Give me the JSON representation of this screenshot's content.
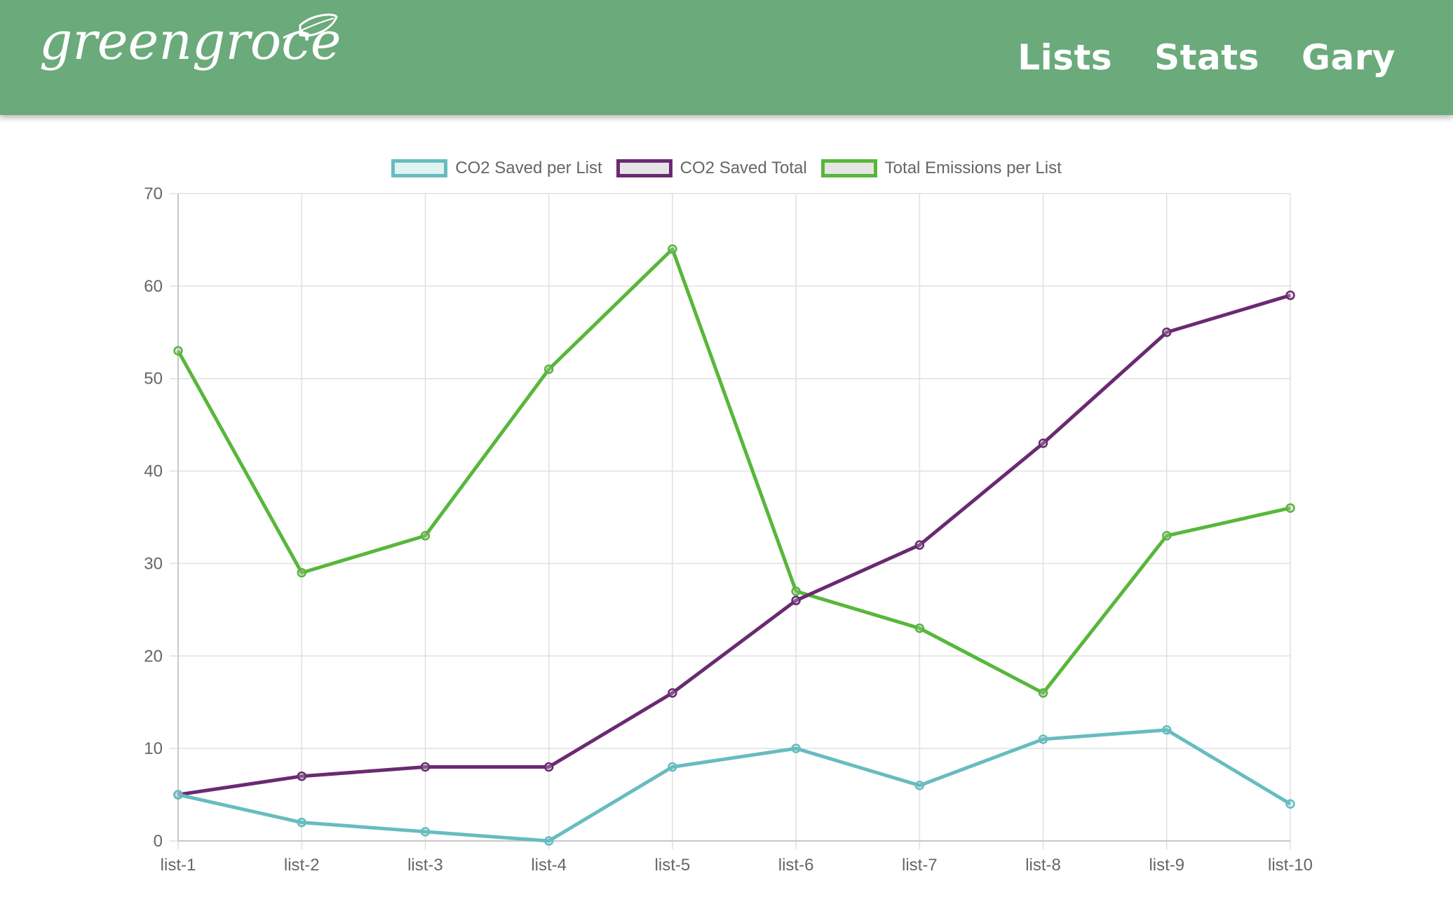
{
  "app": {
    "logo_text": "greengrocer"
  },
  "nav": {
    "items": [
      {
        "label": "Lists"
      },
      {
        "label": "Stats"
      },
      {
        "label": "Gary"
      }
    ]
  },
  "colors": {
    "navbar_bg": "#6aaa7b",
    "series_teal": "#67bcc0",
    "series_purple": "#6a2a72",
    "series_green": "#57b73a",
    "grid": "#e0e0e0",
    "axis_text": "#666666"
  },
  "chart_data": {
    "type": "line",
    "x": [
      "list-1",
      "list-2",
      "list-3",
      "list-4",
      "list-5",
      "list-6",
      "list-7",
      "list-8",
      "list-9",
      "list-10"
    ],
    "ylim": [
      0,
      70
    ],
    "yticks": [
      0,
      10,
      20,
      30,
      40,
      50,
      60,
      70
    ],
    "grid": true,
    "legend_position": "top-center",
    "series": [
      {
        "name": "CO2 Saved per List",
        "color": "#67bcc0",
        "fill": "rgba(103,188,192,0.2)",
        "values": [
          5,
          2,
          1,
          0,
          8,
          10,
          6,
          11,
          12,
          4
        ]
      },
      {
        "name": "CO2 Saved Total",
        "color": "#6a2a72",
        "fill": "rgba(180,180,180,0.35)",
        "values": [
          5,
          7,
          8,
          8,
          16,
          26,
          32,
          43,
          55,
          59
        ]
      },
      {
        "name": "Total Emissions per List",
        "color": "#57b73a",
        "fill": "rgba(180,180,180,0.35)",
        "values": [
          53,
          29,
          33,
          51,
          64,
          27,
          23,
          16,
          33,
          36
        ]
      }
    ]
  }
}
